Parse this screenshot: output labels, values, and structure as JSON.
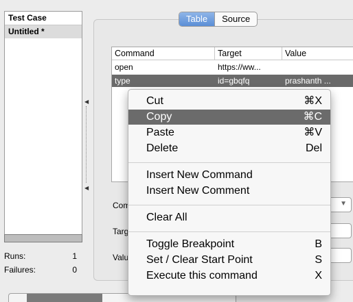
{
  "test_case_panel": {
    "header": "Test Case",
    "items": [
      "Untitled *"
    ],
    "progress": 0
  },
  "stats": {
    "runs_label": "Runs:",
    "runs_value": "1",
    "failures_label": "Failures:",
    "failures_value": "0"
  },
  "view_tabs": {
    "table": "Table",
    "source": "Source"
  },
  "table": {
    "columns": [
      "Command",
      "Target",
      "Value"
    ],
    "rows": [
      {
        "command": "open",
        "target": "https://ww...",
        "value": ""
      },
      {
        "command": "type",
        "target": "id=gbqfq",
        "value": "prashanth ..."
      }
    ]
  },
  "form": {
    "command_label": "Command",
    "target_label": "Target",
    "value_label": "Value"
  },
  "context_menu": {
    "groups": [
      [
        {
          "label": "Cut",
          "shortcut": "⌘X"
        },
        {
          "label": "Copy",
          "shortcut": "⌘C",
          "highlighted": true
        },
        {
          "label": "Paste",
          "shortcut": "⌘V"
        },
        {
          "label": "Delete",
          "shortcut": "Del"
        }
      ],
      [
        {
          "label": "Insert New Command",
          "shortcut": ""
        },
        {
          "label": "Insert New Comment",
          "shortcut": ""
        }
      ],
      [
        {
          "label": "Clear All",
          "shortcut": ""
        }
      ],
      [
        {
          "label": "Toggle Breakpoint",
          "shortcut": "B"
        },
        {
          "label": "Set / Clear Start Point",
          "shortcut": "S"
        },
        {
          "label": "Execute this command",
          "shortcut": "X"
        }
      ]
    ]
  },
  "colors": {
    "selection": "#6b6b6b",
    "active_tab": "#5a8ed6"
  }
}
